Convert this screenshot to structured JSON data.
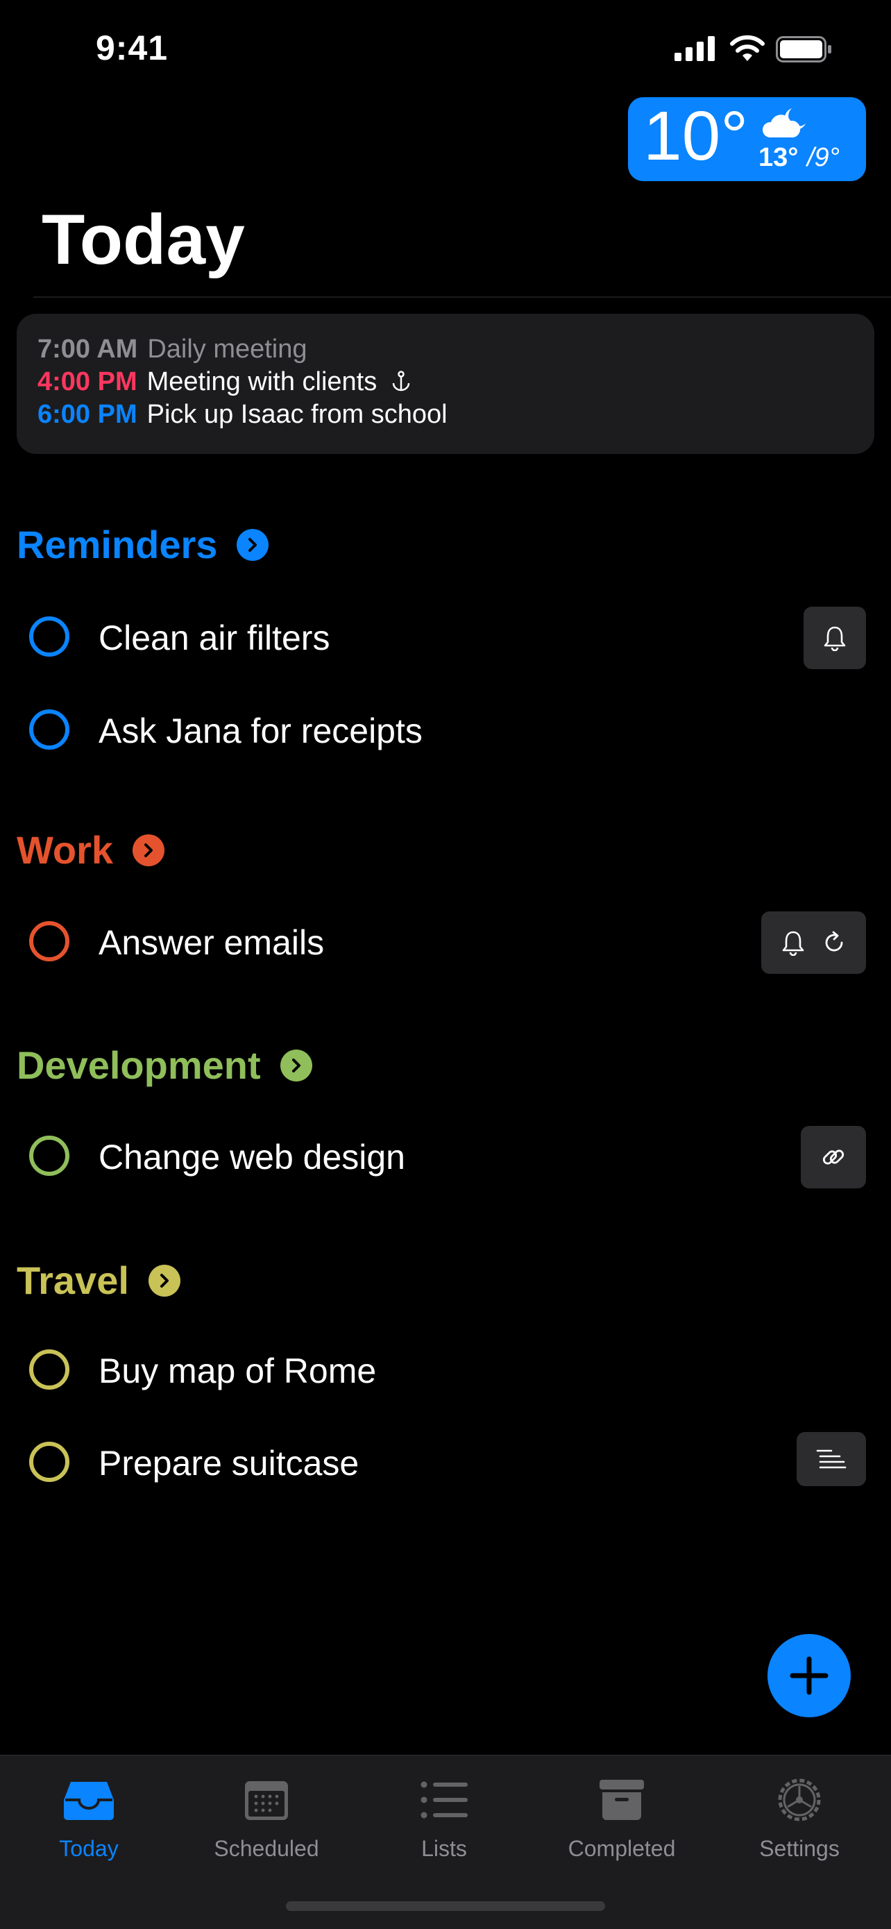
{
  "status_bar": {
    "time": "9:41"
  },
  "weather": {
    "temp": "10°",
    "high": "13°",
    "low": "/9°",
    "condition_icon": "cloud-moon-icon"
  },
  "page": {
    "title": "Today"
  },
  "agenda": [
    {
      "time": "7:00 AM",
      "title": "Daily meeting",
      "time_color": "#8e8e93"
    },
    {
      "time": "4:00 PM",
      "title": "Meeting with clients",
      "time_color": "#ff375f",
      "icon": "anchor-icon"
    },
    {
      "time": "6:00 PM",
      "title": "Pick up Isaac from school",
      "time_color": "#0a84ff"
    }
  ],
  "sections": [
    {
      "name": "Reminders",
      "color": "#0a84ff",
      "tasks": [
        {
          "label": "Clean air filters",
          "badges": [
            "bell-icon"
          ]
        },
        {
          "label": "Ask Jana for receipts",
          "badges": []
        }
      ]
    },
    {
      "name": "Work",
      "color": "#e4532d",
      "tasks": [
        {
          "label": "Answer emails",
          "badges": [
            "bell-icon",
            "repeat-icon"
          ]
        }
      ]
    },
    {
      "name": "Development",
      "color": "#8fbe5a",
      "tasks": [
        {
          "label": "Change web design",
          "badges": [
            "link-icon"
          ]
        }
      ]
    },
    {
      "name": "Travel",
      "color": "#c9c257",
      "tasks": [
        {
          "label": "Buy map of Rome",
          "badges": []
        },
        {
          "label": "Prepare suitcase",
          "badges": [
            "notes-icon"
          ]
        }
      ]
    }
  ],
  "tabbar": {
    "items": [
      {
        "label": "Today",
        "icon": "tray-icon",
        "active": true
      },
      {
        "label": "Scheduled",
        "icon": "calendar-icon",
        "active": false
      },
      {
        "label": "Lists",
        "icon": "list-icon",
        "active": false
      },
      {
        "label": "Completed",
        "icon": "archive-box-icon",
        "active": false
      },
      {
        "label": "Settings",
        "icon": "gear-icon",
        "active": false
      }
    ]
  },
  "colors": {
    "accent": "#0a84ff",
    "card": "#1c1c1e",
    "badge": "#2c2c2e"
  }
}
